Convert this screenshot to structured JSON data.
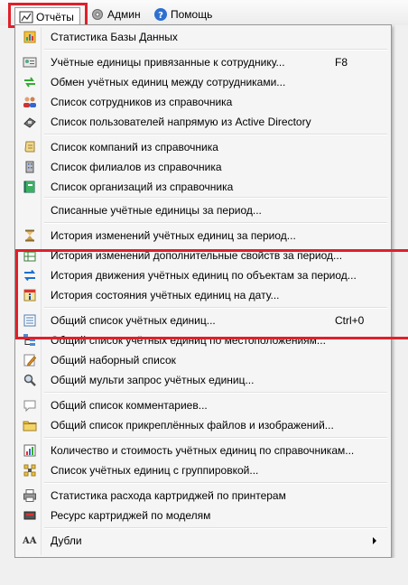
{
  "menubar": {
    "reports": "Отчёты",
    "admin": "Админ",
    "help": "Помощь"
  },
  "menu": {
    "items": [
      {
        "label": "Статистика Базы Данных",
        "icon": "database-stats-icon"
      },
      {
        "label": "Учётные единицы привязанные к сотруднику...",
        "shortcut": "F8",
        "icon": "employee-card-icon"
      },
      {
        "label": "Обмен учётных единиц между сотрудниками...",
        "icon": "exchange-arrows-icon"
      },
      {
        "label": "Список сотрудников из справочника",
        "icon": "users-icon"
      },
      {
        "label": "Список пользователей напрямую из Active Directory",
        "icon": "active-directory-icon"
      },
      {
        "label": "Список компаний из справочника",
        "icon": "scroll-icon"
      },
      {
        "label": "Список филиалов из справочника",
        "icon": "building-icon"
      },
      {
        "label": "Список организаций из справочника",
        "icon": "book-icon"
      },
      {
        "label": "Списанные учётные единицы за период...",
        "icon": "blank-icon"
      },
      {
        "label": "История изменений учётных единиц за период...",
        "icon": "hourglass-icon"
      },
      {
        "label": "История изменений дополнительные свойств за период...",
        "icon": "table-icon"
      },
      {
        "label": "История движения учётных единиц по объектам за период...",
        "icon": "transfer-arrows-icon"
      },
      {
        "label": "История состояния учётных единиц на дату...",
        "icon": "info-calendar-icon"
      },
      {
        "label": "Общий список учётных единиц...",
        "shortcut": "Ctrl+0",
        "icon": "list-icon"
      },
      {
        "label": "Общий список учётных единиц по местоположениям...",
        "icon": "tree-list-icon"
      },
      {
        "label": "Общий наборный список",
        "icon": "pencil-note-icon"
      },
      {
        "label": "Общий мульти запрос учётных единиц...",
        "icon": "magnifier-icon"
      },
      {
        "label": "Общий список комментариев...",
        "icon": "speech-bubble-icon"
      },
      {
        "label": "Общий список прикреплённых файлов и изображений...",
        "icon": "folder-icon"
      },
      {
        "label": "Количество и стоимость учётных единиц по справочникам...",
        "icon": "chart-list-icon"
      },
      {
        "label": "Список учётных единиц с группировкой...",
        "icon": "grouping-icon"
      },
      {
        "label": "Статистика расхода картриджей по принтерам",
        "icon": "printer-icon"
      },
      {
        "label": "Ресурс картриджей по моделям",
        "icon": "cartridge-icon"
      },
      {
        "label": "Дубли",
        "icon": "duplicates-aa-icon",
        "icon_text": "AA"
      }
    ]
  },
  "colors": {
    "highlight": "#e0202a",
    "menu_bg": "#f5f5f5"
  }
}
